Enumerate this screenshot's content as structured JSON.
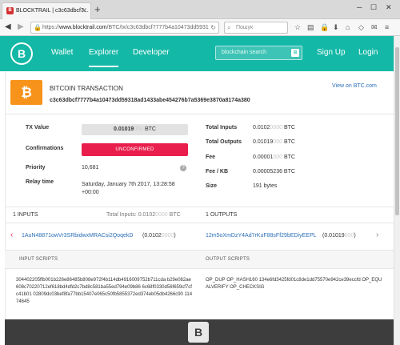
{
  "browser": {
    "tab_title": "BLOCKTRAIL | c3c63dbcf7...",
    "tab_favicon": "B",
    "url_prefix": "https://",
    "url_host": "www.blocktrail.com",
    "url_path": "/BTC/tx/c3c63dbcf7777b4a10473dd5931",
    "search_placeholder": "Пошук"
  },
  "header": {
    "logo": "B",
    "nav": [
      "Wallet",
      "Explorer",
      "Developer"
    ],
    "search_placeholder": "blockchain search",
    "signup": "Sign Up",
    "login": "Login"
  },
  "tx": {
    "label": "BITCOIN TRANSACTION",
    "hash": "c3c63dbcf7777b4a10473dd59318ad1433abe454276b7a5369e3870a8174a380",
    "view_link": "View on BTC.com"
  },
  "details": {
    "tx_value_label": "TX Value",
    "tx_value": "0.01019",
    "tx_value_zeros": "000",
    "tx_value_unit": "BTC",
    "confirmations_label": "Confirmations",
    "confirmations_status": "UNCONFIRMED",
    "priority_label": "Priority",
    "priority": "10,681",
    "relay_label": "Relay time",
    "relay_time": "Saturday, January 7th 2017, 13:28:58 +00:00",
    "total_inputs_label": "Total Inputs",
    "total_inputs": "0.0102",
    "total_inputs_zeros": "0000",
    "total_outputs_label": "Total Outputs",
    "total_outputs": "0.01019",
    "total_outputs_zeros": "000",
    "fee_label": "Fee",
    "fee": "0.00001",
    "fee_zeros": "000",
    "fee_kb_label": "Fee / KB",
    "fee_kb": "0.00005236 BTC",
    "size_label": "Size",
    "size": "191 bytes",
    "unit": "BTC"
  },
  "io": {
    "inputs_header": "1 INPUTS",
    "inputs_total_label": "Total Inputs:",
    "inputs_total": "0.0102",
    "inputs_total_zeros": "0000",
    "outputs_header": "1 OUTPUTS",
    "input_address": "1AuN48871owVr3SRbidwxMRACsi2QoqekD",
    "input_amount": "0.0102",
    "input_amount_zeros": "0000",
    "output_address": "12m5oXmDzY4Ad7rKuF88sFf29bEDiyEEPL",
    "output_amount": "0.01019",
    "output_amount_zeros": "000",
    "unit": "BTC"
  },
  "scripts": {
    "input_title": "INPUT SCRIPTS",
    "output_title": "OUTPUT SCRIPTS",
    "input_script": "304402205ffb001b226e86485b808e972f4b114db4916009752b711cda b29e082ae608c70220712ef618bd4dfd2c7bd8c581ba55ed794e09b86 6c68f0330d56f659cf7cfc41b01 02809dc03bef8fa77bb15407e065c50fb5855372ed374eb05db4266c90 11474645",
    "output_script": "OP_DUP OP_HASH160 134e6fd3425fd01c8de1dd75570e942ce39eccfd OP_EQUALVERIFY OP_CHECKSIG"
  },
  "footer": {
    "logo": "B"
  }
}
